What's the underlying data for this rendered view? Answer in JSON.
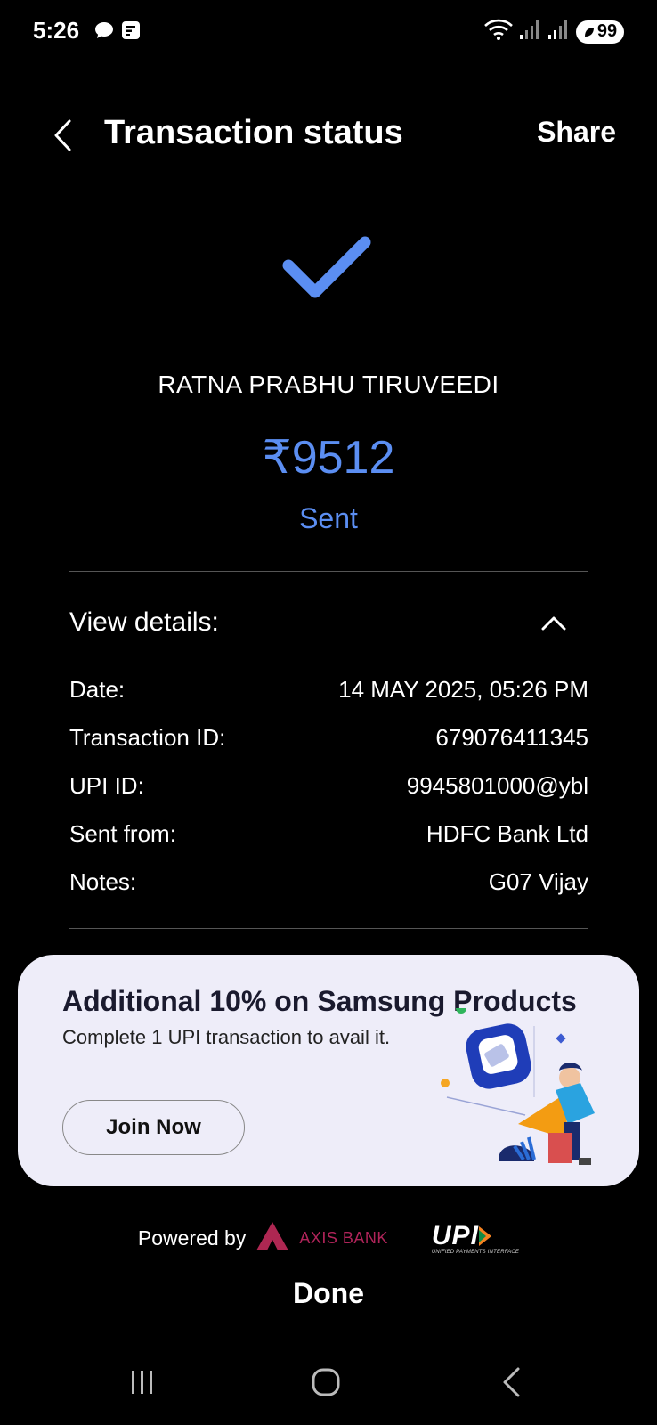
{
  "status_bar": {
    "time": "5:26",
    "battery": "99",
    "icons": [
      "chat-bubble-icon",
      "notification-card-icon",
      "wifi-icon",
      "signal-icon",
      "signal-icon"
    ]
  },
  "header": {
    "title": "Transaction status",
    "share_label": "Share",
    "back_icon": "chevron-left-icon"
  },
  "transaction": {
    "recipient_name": "RATNA PRABHU TIRUVEEDI",
    "amount": "₹9512",
    "status": "Sent",
    "status_color": "#5b8ef2"
  },
  "details": {
    "label": "View details:",
    "toggle_icon": "chevron-up-icon",
    "rows": [
      {
        "label": "Date:",
        "value": "14 MAY 2025, 05:26 PM"
      },
      {
        "label": "Transaction ID:",
        "value": "679076411345"
      },
      {
        "label": "UPI ID:",
        "value": "9945801000@ybl"
      },
      {
        "label": "Sent from:",
        "value": "HDFC Bank Ltd"
      },
      {
        "label": "Notes:",
        "value": "G07 Vijay"
      }
    ]
  },
  "promo": {
    "title": "Additional 10% on Samsung Products",
    "subtitle": "Complete 1 UPI transaction to avail it.",
    "button_label": "Join Now",
    "background": "#eeedf9"
  },
  "footer": {
    "powered_by": "Powered by",
    "bank_name": "AXIS BANK",
    "upi_logo": "UPI",
    "upi_sub": "UNIFIED PAYMENTS INTERFACE",
    "done_label": "Done"
  },
  "navbar": {
    "icons": [
      "recent-apps-icon",
      "home-icon",
      "back-icon"
    ]
  }
}
